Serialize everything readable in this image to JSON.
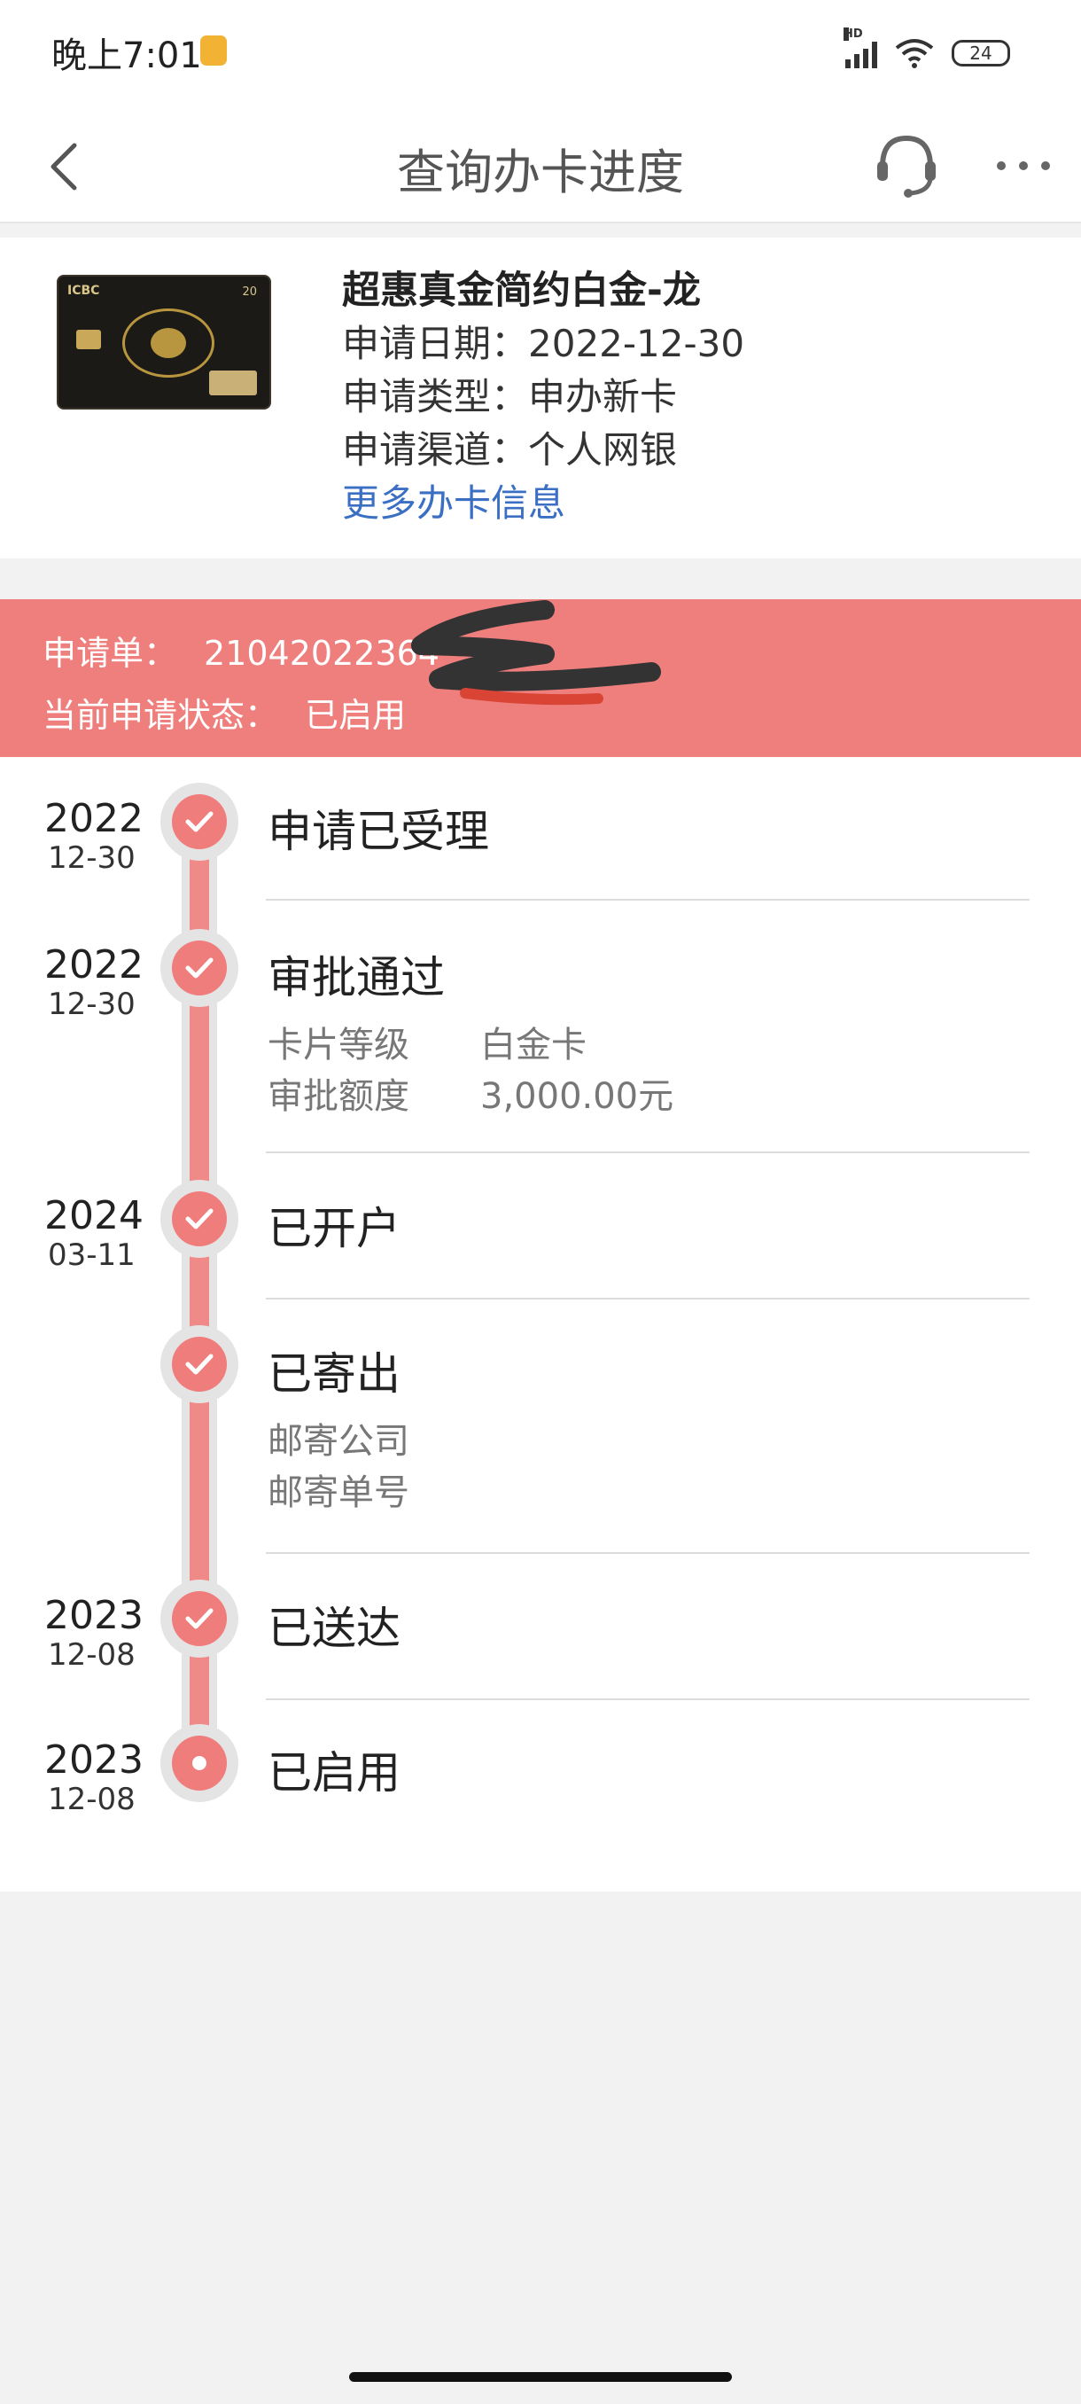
{
  "status_bar": {
    "time": "晚上7:01",
    "network_label": "HD",
    "battery": "24"
  },
  "nav": {
    "title": "查询办卡进度"
  },
  "card": {
    "name": "超惠真金简约白金-龙",
    "apply_date_label": "申请日期：",
    "apply_date": "2022-12-30",
    "apply_type_label": "申请类型：",
    "apply_type": "申办新卡",
    "apply_channel_label": "申请渠道：",
    "apply_channel": "个人网银",
    "more_info_link": "更多办卡信息",
    "card_logo_text": "ICBC",
    "card_badge_text": "20"
  },
  "application": {
    "number_label": "申请单：",
    "number_visible": "21042022364",
    "status_label": "当前申请状态：",
    "status": "已启用"
  },
  "timeline": [
    {
      "year": "2022",
      "date": "12-30",
      "title": "申请已受理",
      "details": []
    },
    {
      "year": "2022",
      "date": "12-30",
      "title": "审批通过",
      "details": [
        {
          "label": "卡片等级",
          "value": "白金卡"
        },
        {
          "label": "审批额度",
          "value": "3,000.00元"
        }
      ]
    },
    {
      "year": "2024",
      "date": "03-11",
      "title": "已开户",
      "details": []
    },
    {
      "year": "",
      "date": "",
      "title": "已寄出",
      "details": [
        {
          "label": "邮寄公司",
          "value": ""
        },
        {
          "label": "邮寄单号",
          "value": ""
        }
      ]
    },
    {
      "year": "2023",
      "date": "12-08",
      "title": "已送达",
      "details": []
    },
    {
      "year": "2023",
      "date": "12-08",
      "title": "已启用",
      "details": []
    }
  ],
  "colors": {
    "accent": "#ee7f7d",
    "link": "#3b6fc4",
    "timeline_dot": "#ef7d7c"
  },
  "icons": {
    "back": "chevron-left-icon",
    "support": "headset-icon",
    "more": "more-dots-icon",
    "check": "check-icon"
  }
}
